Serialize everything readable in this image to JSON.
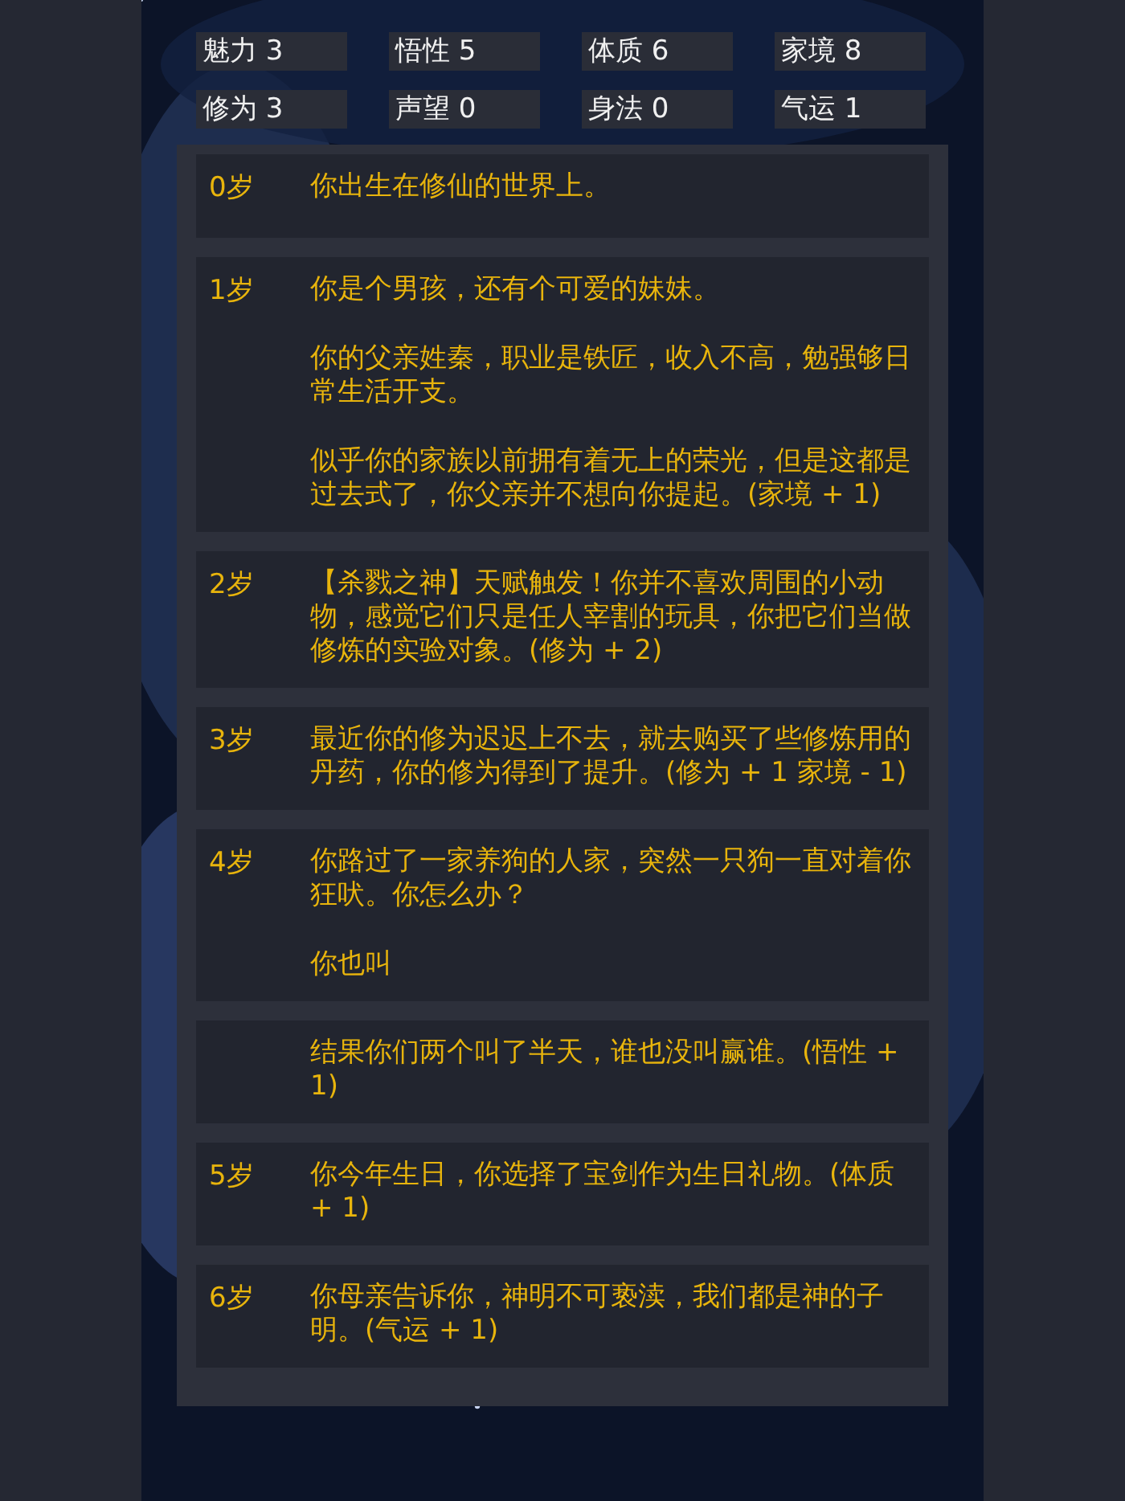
{
  "stats": [
    {
      "label": "魅力 3"
    },
    {
      "label": "悟性 5"
    },
    {
      "label": "体质 6"
    },
    {
      "label": "家境 8"
    },
    {
      "label": "修为 3"
    },
    {
      "label": "声望 0"
    },
    {
      "label": "身法 0"
    },
    {
      "label": "气运 1"
    }
  ],
  "events": [
    {
      "age": "0岁",
      "paragraphs": [
        "你出生在修仙的世界上。"
      ]
    },
    {
      "age": "1岁",
      "paragraphs": [
        "你是个男孩，还有个可爱的妹妹。",
        "你的父亲姓秦，职业是铁匠，收入不高，勉强够日常生活开支。",
        "似乎你的家族以前拥有着无上的荣光，但是这都是过去式了，你父亲并不想向你提起。(家境 + 1)"
      ]
    },
    {
      "age": "2岁",
      "paragraphs": [
        "【杀戮之神】天赋触发！你并不喜欢周围的小动物，感觉它们只是任人宰割的玩具，你把它们当做修炼的实验对象。(修为 + 2)"
      ]
    },
    {
      "age": "3岁",
      "paragraphs": [
        "最近你的修为迟迟上不去，就去购买了些修炼用的丹药，你的修为得到了提升。(修为 + 1 家境 - 1)"
      ]
    },
    {
      "age": "4岁",
      "paragraphs": [
        "你路过了一家养狗的人家，突然一只狗一直对着你狂吠。你怎么办？",
        "你也叫"
      ]
    },
    {
      "paragraphs": [
        "结果你们两个叫了半天，谁也没叫赢谁。(悟性 + 1)"
      ]
    },
    {
      "age": "5岁",
      "paragraphs": [
        "你今年生日，你选择了宝剑作为生日礼物。(体质 + 1)"
      ]
    },
    {
      "age": "6岁",
      "paragraphs": [
        "你母亲告诉你，神明不可亵渎，我们都是神的子明。(气运 + 1)"
      ]
    }
  ]
}
